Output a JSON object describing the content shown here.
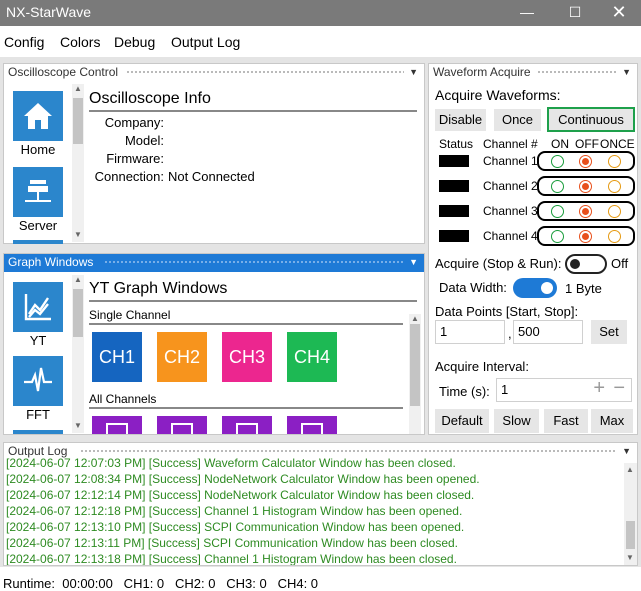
{
  "window": {
    "title": "NX-StarWave"
  },
  "menu": [
    "Config",
    "Colors",
    "Debug",
    "Output Log"
  ],
  "osc_control": {
    "panel_title": "Oscilloscope Control",
    "nav": [
      {
        "label": "Home",
        "icon": "home-icon"
      },
      {
        "label": "Server",
        "icon": "server-icon"
      }
    ],
    "info_title": "Oscilloscope Info",
    "fields": [
      {
        "label": "Company:",
        "value": ""
      },
      {
        "label": "Model:",
        "value": ""
      },
      {
        "label": "Firmware:",
        "value": ""
      },
      {
        "label": "Connection:",
        "value": "Not Connected"
      }
    ]
  },
  "graph_windows": {
    "panel_title": "Graph Windows",
    "nav": [
      {
        "label": "YT",
        "icon": "chart-line-icon"
      },
      {
        "label": "FFT",
        "icon": "pulse-icon"
      }
    ],
    "title": "YT Graph Windows",
    "single_label": "Single Channel",
    "channels": [
      {
        "label": "CH1",
        "color": "#1565c0"
      },
      {
        "label": "CH2",
        "color": "#f7941d"
      },
      {
        "label": "CH3",
        "color": "#ec268f"
      },
      {
        "label": "CH4",
        "color": "#1db954"
      }
    ],
    "all_label": "All Channels",
    "all_color": "#8b1fc4"
  },
  "acquire": {
    "panel_title": "Waveform Acquire",
    "acquire_waveforms": "Acquire Waveforms:",
    "modes": [
      "Disable",
      "Once",
      "Continuous"
    ],
    "selected_mode": "Continuous",
    "status_header": "Status",
    "channel_header": "Channel #",
    "col_headers": [
      "ON",
      "OFF",
      "ONCE"
    ],
    "channels": [
      "Channel 1",
      "Channel 2",
      "Channel 3",
      "Channel 4"
    ],
    "channel_state": "OFF",
    "stop_run_label": "Acquire (Stop & Run):",
    "stop_run_state": "Off",
    "data_width_label": "Data Width:",
    "data_width_value": "1 Byte",
    "data_points_label": "Data Points [Start, Stop]:",
    "start": "1",
    "stop": "500",
    "separator": ",",
    "set_label": "Set",
    "interval_label": "Acquire Interval:",
    "time_label": "Time (s):",
    "time_value": "1",
    "presets": [
      "Default",
      "Slow",
      "Fast",
      "Max"
    ]
  },
  "output_log": {
    "panel_title": "Output Log",
    "lines": [
      "[2024-06-07 12:07:03 PM] [Success] Waveform Calculator Window has been closed.",
      "[2024-06-07 12:08:34 PM] [Success] NodeNetwork Calculator Window has been opened.",
      "[2024-06-07 12:12:14 PM] [Success] NodeNetwork Calculator Window has been closed.",
      "[2024-06-07 12:12:18 PM] [Success] Channel 1 Histogram Window has been opened.",
      "[2024-06-07 12:13:10 PM] [Success] SCPI Communication Window has been opened.",
      "[2024-06-07 12:13:11 PM] [Success] SCPI Communication Window has been closed.",
      "[2024-06-07 12:13:18 PM] [Success] Channel 1 Histogram Window has been closed."
    ]
  },
  "statusbar": {
    "text": "Runtime:  00:00:00   CH1: 0   CH2: 0   CH3: 0   CH4: 0"
  }
}
